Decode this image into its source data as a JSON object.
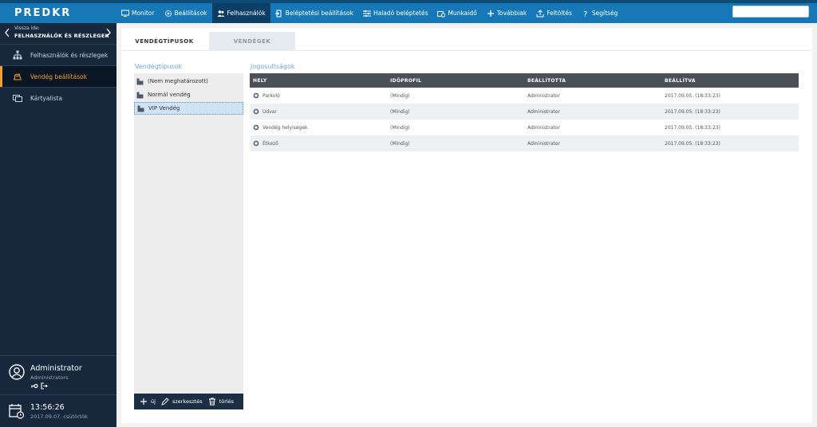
{
  "app": {
    "logo": "PREDKR"
  },
  "nav": {
    "items": [
      {
        "label": "Monitor",
        "icon": "monitor-icon"
      },
      {
        "label": "Beállítások",
        "icon": "gear-icon"
      },
      {
        "label": "Felhasználók",
        "icon": "users-icon",
        "active": true
      },
      {
        "label": "Beléptetési beállítások",
        "icon": "door-icon"
      },
      {
        "label": "Haladó beléptetés",
        "icon": "sliders-icon"
      },
      {
        "label": "Munkaidő",
        "icon": "worktime-icon"
      },
      {
        "label": "Továbbiak",
        "icon": "plus-icon"
      },
      {
        "label": "Feltöltés",
        "icon": "upload-icon"
      },
      {
        "label": "Segítség",
        "icon": "help-icon"
      }
    ],
    "search_placeholder": ""
  },
  "sidebar": {
    "back_small": "Vissza ide:",
    "back_title": "FELHASZNÁLÓK ÉS RÉSZLEGEK",
    "items": [
      {
        "label": "Felhasználók és részlegek",
        "icon": "hierarchy-icon"
      },
      {
        "label": "Vendég beállítások",
        "icon": "guest-settings-icon",
        "active": true
      },
      {
        "label": "Kártyalista",
        "icon": "cards-icon"
      }
    ],
    "user": {
      "name": "Administrator",
      "role": "Administrators"
    },
    "clock": {
      "time": "13:56:26",
      "date": "2017.09.07. csütörtök"
    }
  },
  "tabs": [
    {
      "label": "VENDÉGTÍPUSOK",
      "active": true
    },
    {
      "label": "VENDÉGEK",
      "active": false
    }
  ],
  "guest_types": {
    "title": "Vendégtípusok",
    "items": [
      {
        "label": "(Nem meghatározott)"
      },
      {
        "label": "Normál vendég"
      },
      {
        "label": "VIP Vendég",
        "selected": true
      }
    ],
    "footer": {
      "new": "új",
      "edit": "szerkesztés",
      "delete": "törlés"
    }
  },
  "permissions": {
    "title": "Jogosultságok",
    "columns": [
      "HELY",
      "IDŐPROFIL",
      "BEÁLLÍTOTTA",
      "BEÁLLÍTVA"
    ],
    "rows": [
      [
        "Parkoló",
        "(Mindig)",
        "Administrator",
        "2017.09.05. (18:33:23)"
      ],
      [
        "Udvar",
        "(Mindig)",
        "Administrator",
        "2017.09.05. (18:33:23)"
      ],
      [
        "Vendég helyiségek",
        "(Mindig)",
        "Administrator",
        "2017.09.05. (18:33:23)"
      ],
      [
        "Étkező",
        "(Mindig)",
        "Administrator",
        "2017.09.05. (18:33:23)"
      ]
    ]
  },
  "colors": {
    "topbar": "#1678b6",
    "sidebar": "#17283d",
    "accent": "#f0a030",
    "link": "#6ea6d8"
  }
}
